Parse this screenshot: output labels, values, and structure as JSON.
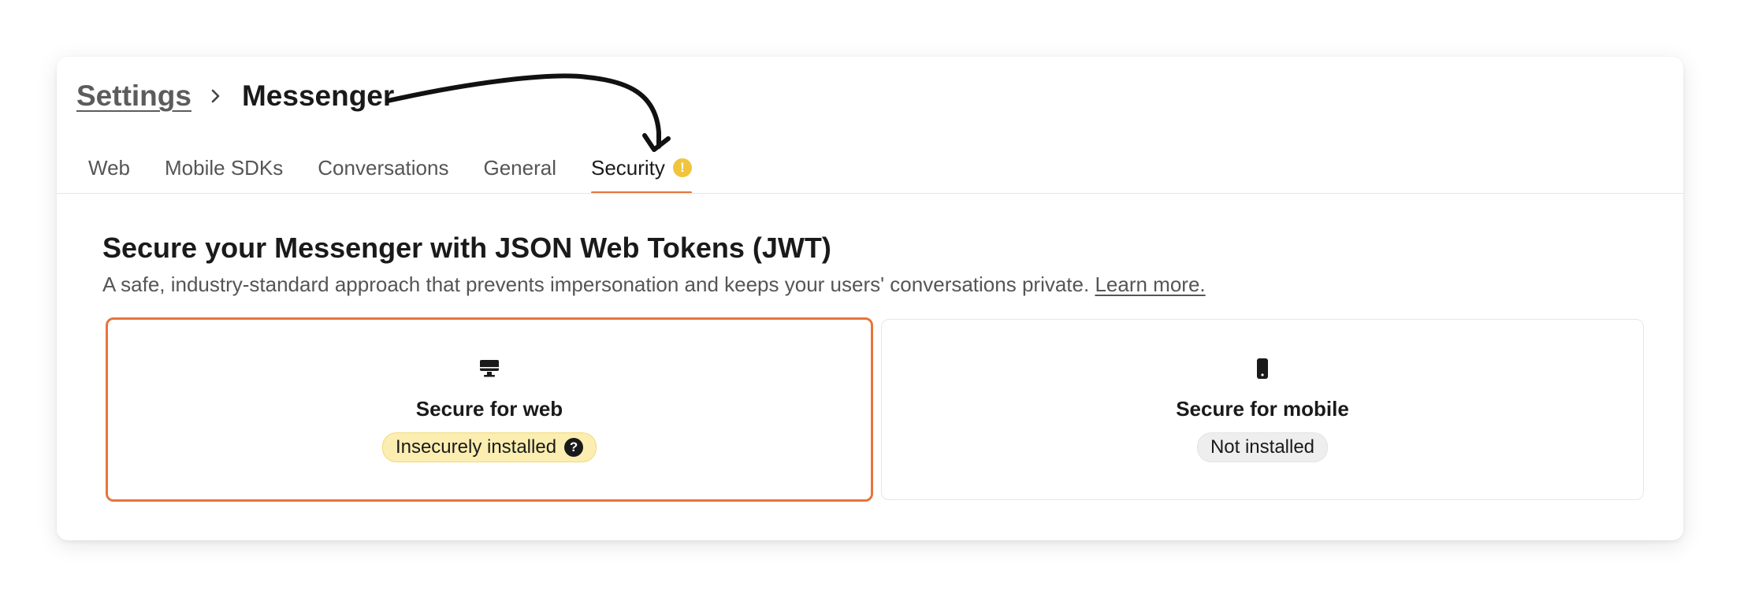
{
  "breadcrumb": {
    "parent": "Settings",
    "current": "Messenger"
  },
  "tabs": [
    {
      "label": "Web",
      "active": false
    },
    {
      "label": "Mobile SDKs",
      "active": false
    },
    {
      "label": "Conversations",
      "active": false
    },
    {
      "label": "General",
      "active": false
    },
    {
      "label": "Security",
      "active": true,
      "warning_icon": "!"
    }
  ],
  "section": {
    "title": "Secure your Messenger with JSON Web Tokens (JWT)",
    "description": "A safe, industry-standard approach that prevents impersonation and keeps your users' conversations private.",
    "learn_more": "Learn more."
  },
  "cards": {
    "web": {
      "icon": "desktop-icon",
      "title": "Secure for web",
      "status": "Insecurely installed",
      "status_icon": "?"
    },
    "mobile": {
      "icon": "mobile-phone-icon",
      "title": "Secure for mobile",
      "status": "Not installed"
    }
  },
  "colors": {
    "accent": "#e8743b",
    "warning": "#f0c53d",
    "warning_badge_bg": "#fbeeb0",
    "neutral_badge_bg": "#eeeeee"
  }
}
